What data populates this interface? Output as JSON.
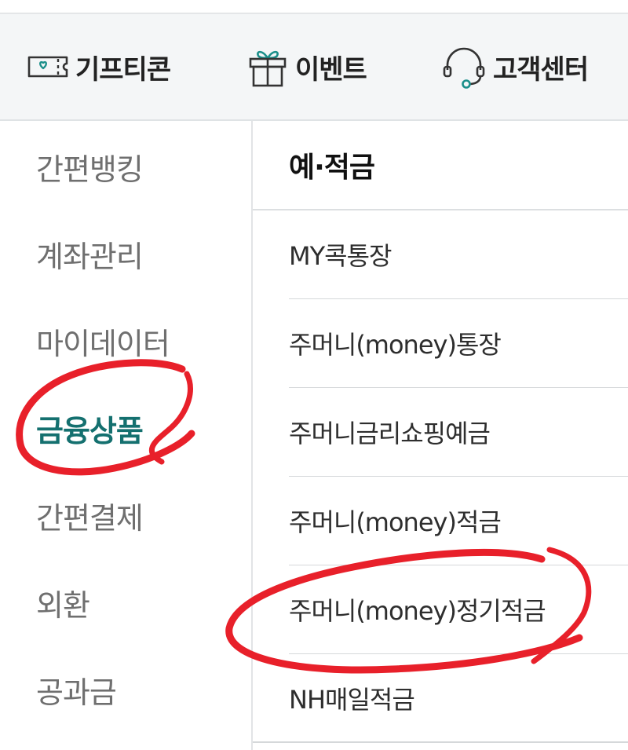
{
  "quick_bar": {
    "items": [
      {
        "label": "기프티콘",
        "icon": "gift-ticket-icon"
      },
      {
        "label": "이벤트",
        "icon": "gift-box-icon"
      },
      {
        "label": "고객센터",
        "icon": "headset-icon"
      }
    ]
  },
  "left_nav": {
    "items": [
      {
        "label": "간편뱅킹"
      },
      {
        "label": "계좌관리"
      },
      {
        "label": "마이데이터"
      },
      {
        "label": "금융상품"
      },
      {
        "label": "간편결제"
      },
      {
        "label": "외환"
      },
      {
        "label": "공과금"
      }
    ],
    "active_index": 3
  },
  "content": {
    "section_title": "예·적금",
    "items": [
      {
        "label": "MY콕통장"
      },
      {
        "label": "주머니(money)통장"
      },
      {
        "label": "주머니금리쇼핑예금"
      },
      {
        "label": "주머니(money)적금"
      },
      {
        "label": "주머니(money)정기적금"
      },
      {
        "label": "NH매일적금"
      }
    ]
  },
  "colors": {
    "accent_teal": "#14706f",
    "icon_teal": "#1a8f8a",
    "annotation_red": "#e8202a",
    "quick_bar_bg": "#f4f6f7"
  }
}
